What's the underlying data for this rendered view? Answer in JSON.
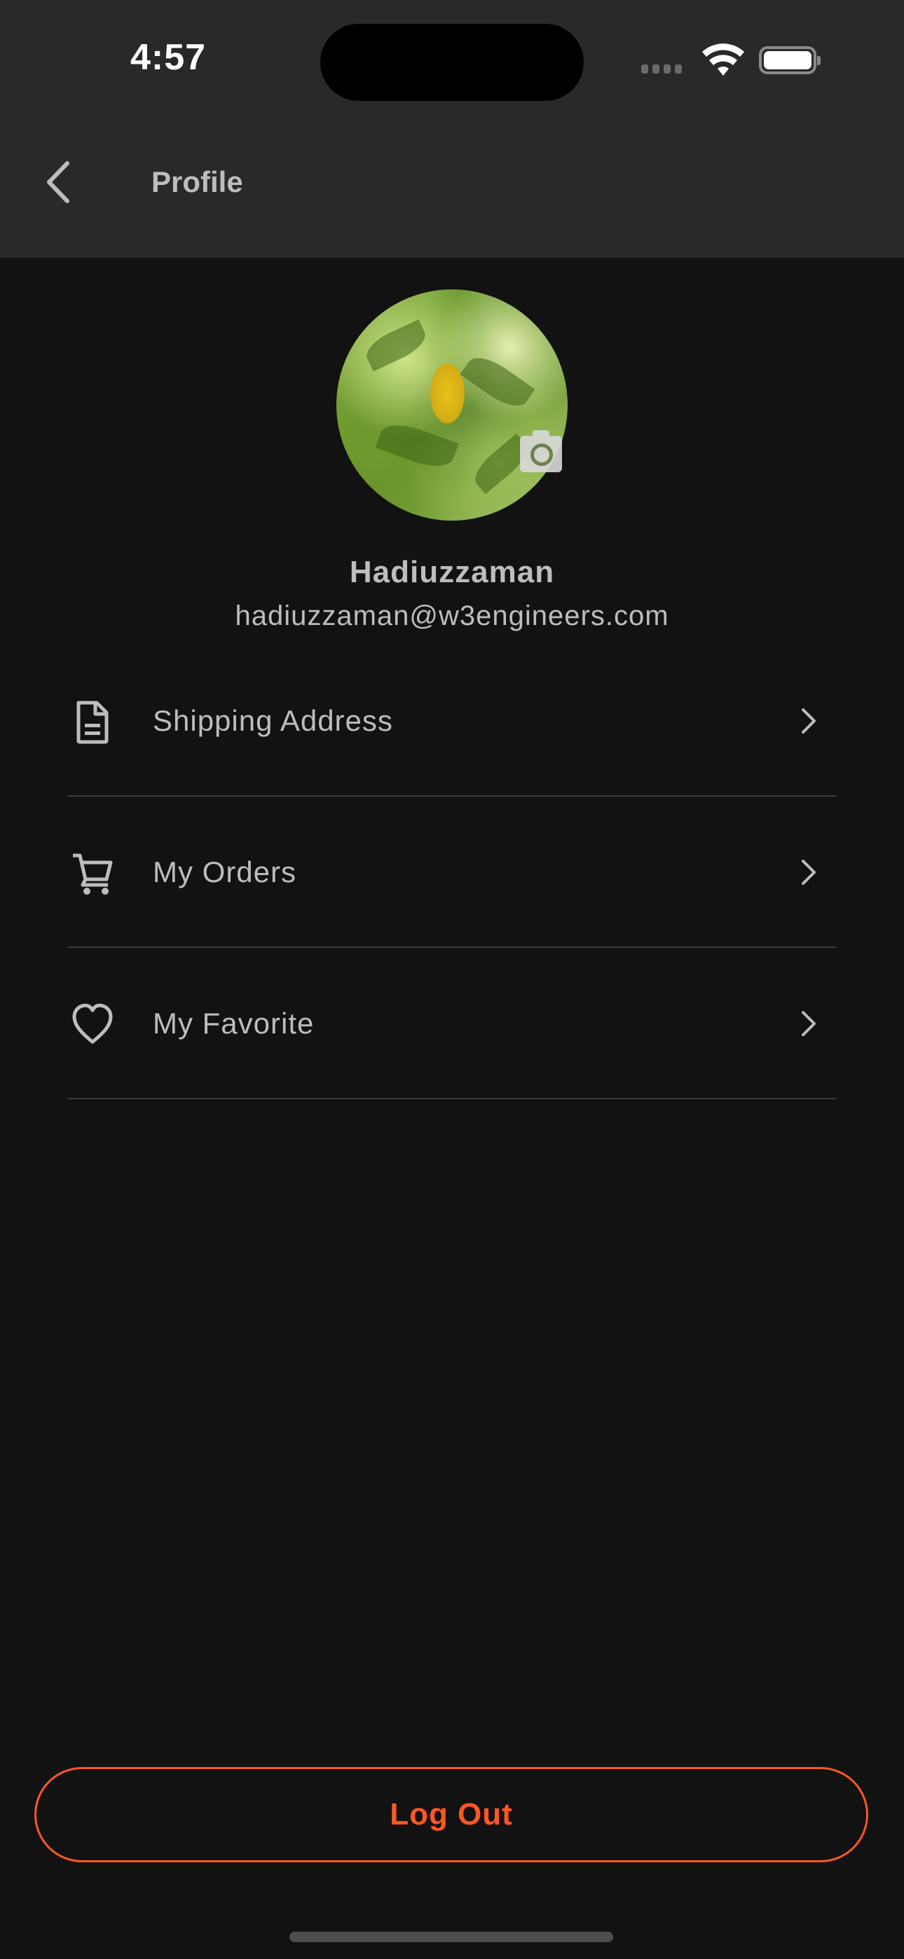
{
  "status_bar": {
    "time": "4:57",
    "icons": [
      "cellular-signal-icon",
      "wifi-icon",
      "battery-icon"
    ]
  },
  "nav": {
    "back_icon": "chevron-left-icon",
    "title": "Profile"
  },
  "profile": {
    "avatar_description": "green leaves with yellow leaf photo",
    "camera_icon": "camera-icon",
    "name": "Hadiuzzaman",
    "email": "hadiuzzaman@w3engineers.com"
  },
  "menu": {
    "items": [
      {
        "icon": "document-icon",
        "label": "Shipping Address"
      },
      {
        "icon": "cart-icon",
        "label": "My Orders"
      },
      {
        "icon": "heart-icon",
        "label": "My Favorite"
      }
    ],
    "chevron_icon": "chevron-right-icon"
  },
  "logout": {
    "label": "Log Out"
  },
  "colors": {
    "background": "#121212",
    "header": "#292929",
    "text": "#bdbdbd",
    "accent": "#ff5722",
    "divider": "#3a3a3a"
  }
}
